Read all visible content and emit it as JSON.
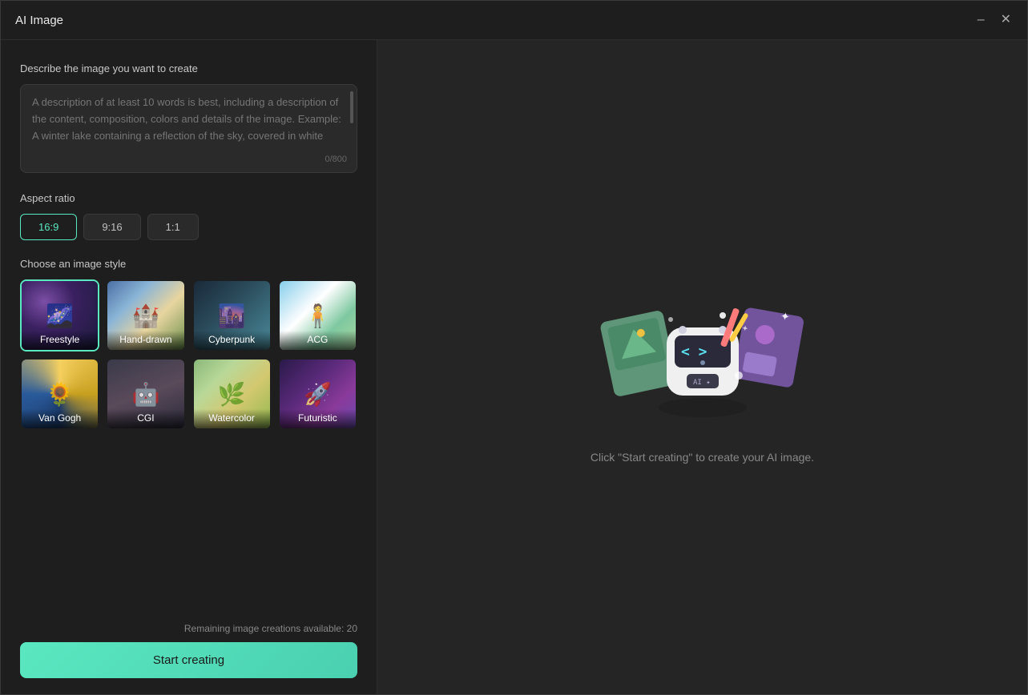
{
  "window": {
    "title": "AI Image"
  },
  "titleBar": {
    "title": "AI Image",
    "minimizeLabel": "minimize",
    "closeLabel": "close"
  },
  "leftPanel": {
    "describeLabel": "Describe the image you want to create",
    "textareaPlaceholder": "A description of at least 10 words is best, including a description of the content, composition, colors and details of the image. Example: A winter lake containing a reflection of the sky, covered in white",
    "charCount": "0/800",
    "aspectRatioLabel": "Aspect ratio",
    "ratioOptions": [
      {
        "value": "16:9",
        "active": true
      },
      {
        "value": "9:16",
        "active": false
      },
      {
        "value": "1:1",
        "active": false
      }
    ],
    "imageStyleLabel": "Choose an image style",
    "styles": [
      {
        "name": "Freestyle",
        "bg": "freestyle",
        "active": true
      },
      {
        "name": "Hand-drawn",
        "bg": "handdrawn",
        "active": false
      },
      {
        "name": "Cyberpunk",
        "bg": "cyberpunk",
        "active": false
      },
      {
        "name": "ACG",
        "bg": "acg",
        "active": false
      },
      {
        "name": "Van Gogh",
        "bg": "vangogh",
        "active": false
      },
      {
        "name": "CGI",
        "bg": "cgi",
        "active": false
      },
      {
        "name": "Watercolor",
        "bg": "watercolor",
        "active": false
      },
      {
        "name": "Futuristic",
        "bg": "futuristic",
        "active": false
      }
    ],
    "remainingText": "Remaining image creations available: 20",
    "startButtonLabel": "Start creating"
  },
  "rightPanel": {
    "hintText": "Click \"Start creating\" to create your AI image."
  }
}
